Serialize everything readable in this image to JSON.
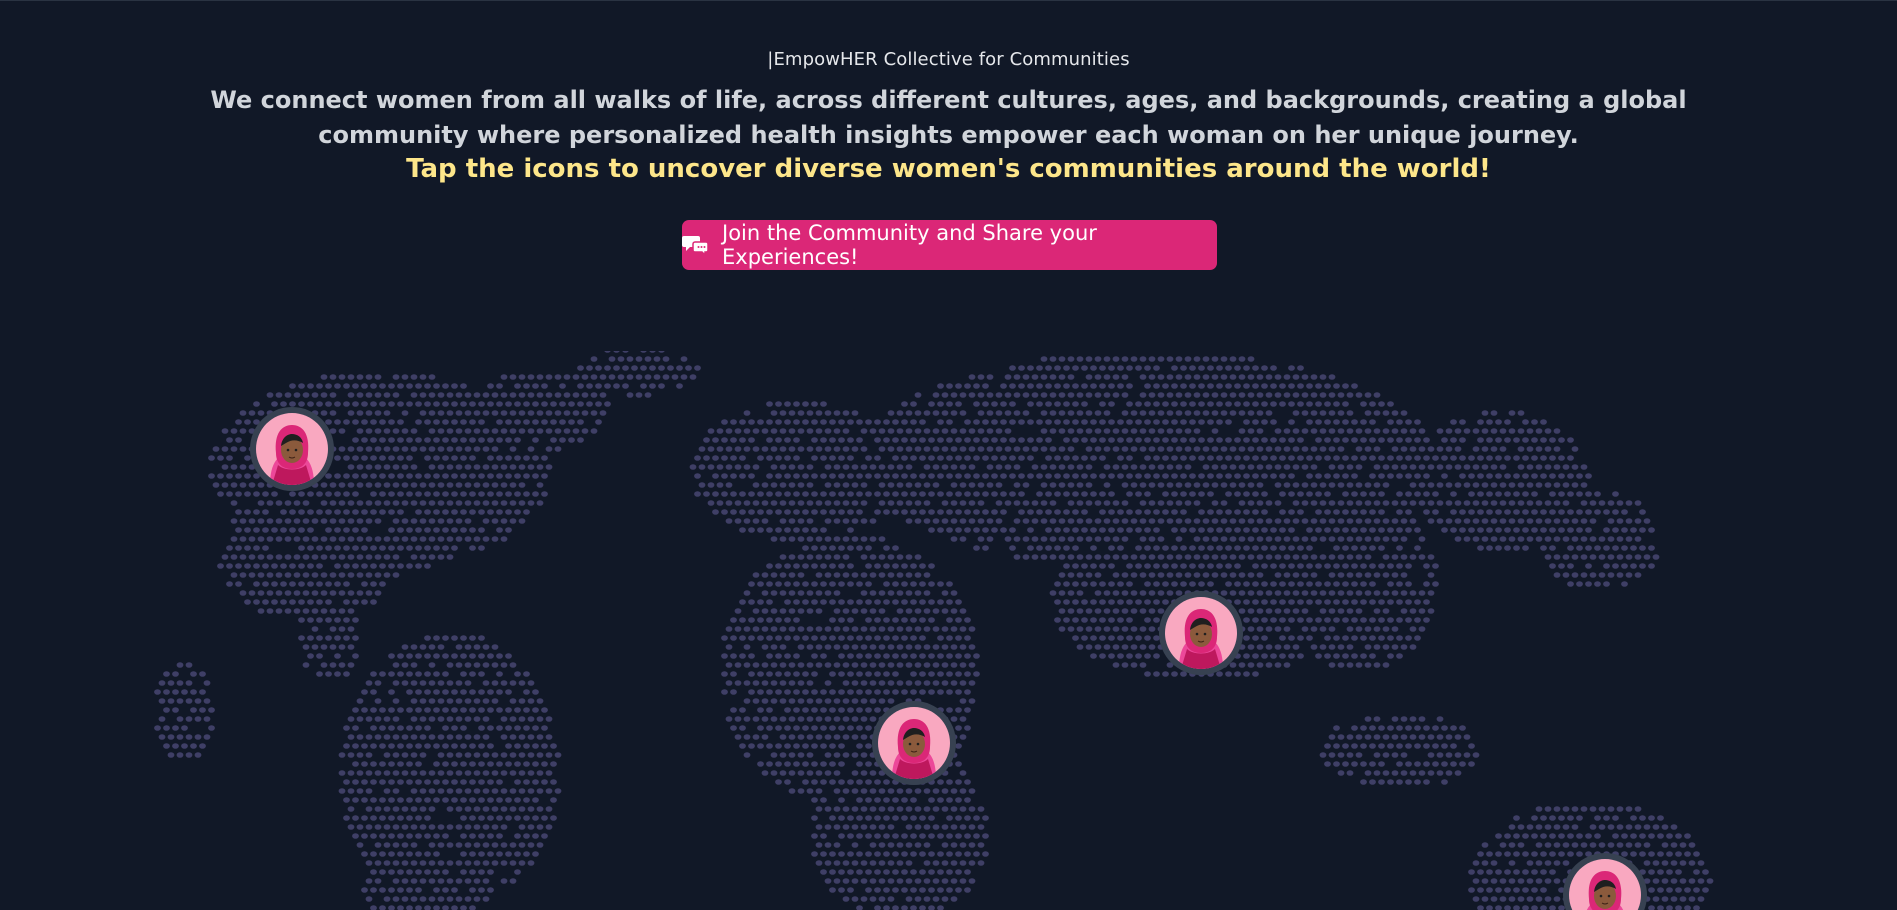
{
  "header": {
    "brand": "|EmpowHER Collective for Communities",
    "tagline": "We connect women from all walks of life, across different cultures, ages, and backgrounds, creating a global community where personalized health insights empower each woman on her unique journey.",
    "cta_text": "Tap the icons to uncover diverse women's communities around the world!"
  },
  "join_button": {
    "label": "Join the Community and Share your Experiences!",
    "icon": "chat-bubbles-icon"
  },
  "colors": {
    "background": "#111827",
    "accent": "#db2777",
    "highlight": "#fde68a",
    "map_dots": "#3f3f66"
  },
  "markers": [
    {
      "name": "community-marker-north-america",
      "icon": "woman-avatar-icon"
    },
    {
      "name": "community-marker-africa",
      "icon": "woman-avatar-icon"
    },
    {
      "name": "community-marker-south-asia",
      "icon": "woman-avatar-icon"
    },
    {
      "name": "community-marker-australia",
      "icon": "woman-avatar-icon"
    }
  ]
}
